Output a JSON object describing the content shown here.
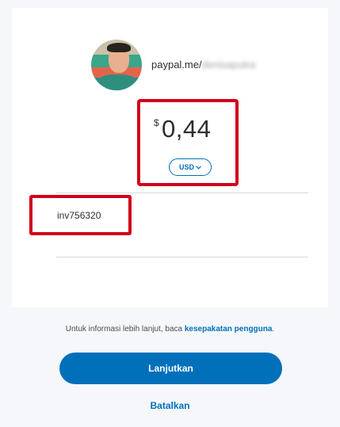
{
  "profile": {
    "link_prefix": "paypal.me/",
    "link_user": "denisaputra",
    "avatar_icon": "user-avatar"
  },
  "payment": {
    "currency_symbol": "$",
    "amount": "0,44",
    "currency_code": "USD",
    "currency_chevron": "chevron-down-icon"
  },
  "note": {
    "text": "inv756320"
  },
  "footer": {
    "info_prefix": "Untuk informasi lebih lanjut, baca ",
    "info_link": "kesepakatan pengguna",
    "info_suffix": ".",
    "continue_label": "Lanjutkan",
    "cancel_label": "Batalkan"
  },
  "colors": {
    "brand": "#0070ba",
    "highlight": "#d0021b",
    "background": "#f5f7fa"
  }
}
